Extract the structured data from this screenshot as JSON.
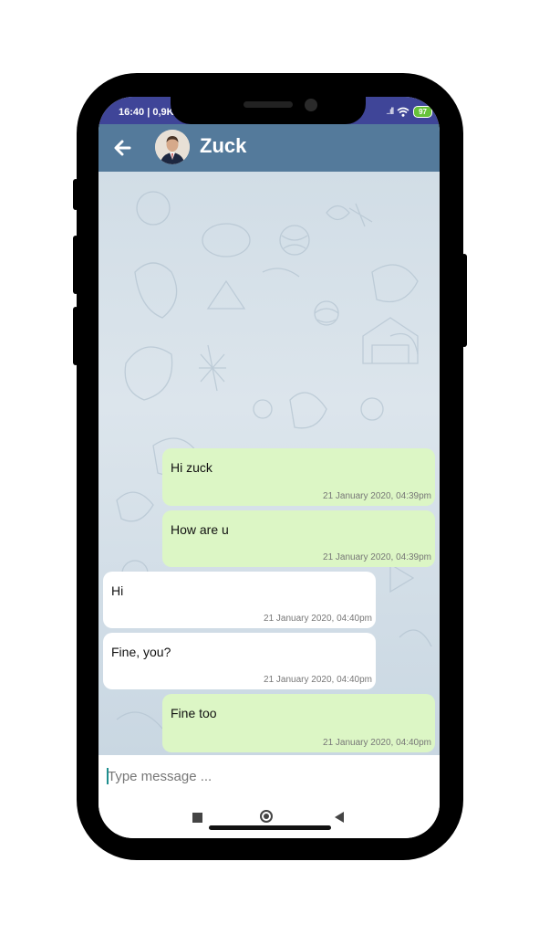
{
  "status_bar": {
    "time": "16:40 | 0,9K",
    "battery": "97",
    "signal": "..ıll"
  },
  "header": {
    "contact_name": "Zuck",
    "back_icon": "arrow-left-icon",
    "avatar": "contact-avatar-photo"
  },
  "messages": [
    {
      "direction": "out",
      "text": "Hi zuck",
      "time": "21 January 2020, 04:39pm"
    },
    {
      "direction": "out",
      "text": "How are u",
      "time": "21 January 2020, 04:39pm"
    },
    {
      "direction": "in",
      "text": "Hi",
      "time": "21 January 2020, 04:40pm"
    },
    {
      "direction": "in",
      "text": "Fine, you?",
      "time": "21 January 2020, 04:40pm"
    },
    {
      "direction": "out",
      "text": "Fine too",
      "time": "21 January 2020, 04:40pm"
    }
  ],
  "composer": {
    "placeholder": "Type message ...",
    "value": ""
  },
  "colors": {
    "status_bar": "#3f4598",
    "app_bar": "#547a9b",
    "outgoing_bubble": "#dcf6c5",
    "incoming_bubble": "#ffffff",
    "battery": "#67c23a"
  }
}
